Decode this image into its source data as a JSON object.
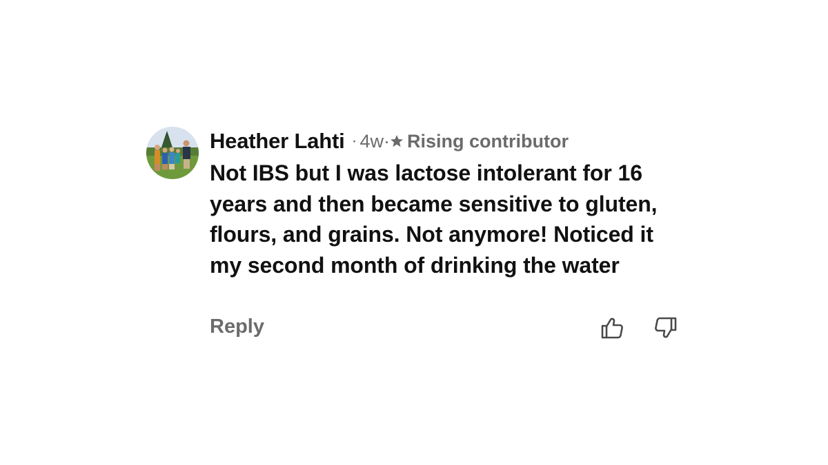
{
  "comment": {
    "author": "Heather Lahti",
    "separator": "·",
    "time": "4w·",
    "badge_icon": "star-icon",
    "badge": "Rising contributor",
    "text": "Not IBS but I was lactose intolerant for 16 years and then became sensitive to gluten, flours, and grains. Not anymore! Noticed it my second month of drinking the water",
    "avatar_icon": "profile-photo"
  },
  "actions": {
    "reply_label": "Reply",
    "like_icon": "thumbs-up-icon",
    "dislike_icon": "thumbs-down-icon"
  },
  "colors": {
    "text": "#111111",
    "muted": "#6b6b6b",
    "background": "#ffffff"
  }
}
